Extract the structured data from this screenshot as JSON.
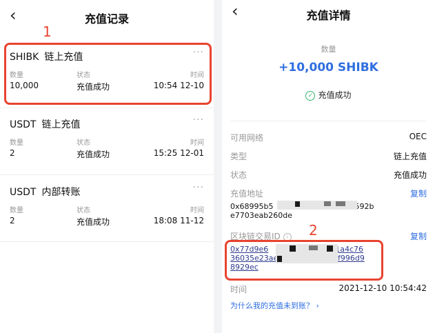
{
  "left": {
    "title": "充值记录",
    "annotation": "1",
    "records": [
      {
        "currency": "SHIBK",
        "type": "链上充值",
        "more": "···",
        "qty_label": "数量",
        "qty": "10,000",
        "status_label": "状态",
        "status": "充值成功",
        "time_label": "时间",
        "time": "10:54 12-10"
      },
      {
        "currency": "USDT",
        "type": "链上充值",
        "more": "···",
        "qty_label": "数量",
        "qty": "2",
        "status_label": "状态",
        "status": "充值成功",
        "time_label": "时间",
        "time": "15:25 12-01"
      },
      {
        "currency": "USDT",
        "type": "内部转账",
        "more": "···",
        "qty_label": "数量",
        "qty": "2",
        "status_label": "状态",
        "status": "充值成功",
        "time_label": "时间",
        "time": "18:08 11-12"
      }
    ]
  },
  "right": {
    "title": "充值详情",
    "amount_label": "数量",
    "amount": "+10,000 SHIBK",
    "status": "充值成功",
    "annotation": "2",
    "rows": {
      "network": {
        "label": "可用网络",
        "value": "OEC"
      },
      "type": {
        "label": "类型",
        "value": "链上充值"
      },
      "status": {
        "label": "状态",
        "value": "充值成功"
      }
    },
    "address_label": "充值地址",
    "copy_label": "复制",
    "address_line1_start": "0x68995b5",
    "address_line1_end": "592b",
    "address_line2": "e7703eab260de",
    "txid_label": "区块链交易ID",
    "txid_line1_start": "0x77d9e6",
    "txid_line1_end": "61a4c76",
    "txid_line2_start": "36035e23ae",
    "txid_line2_end": "af996d9",
    "txid_line3": "8929ec",
    "time_label": "时间",
    "time_value": "2021-12-10 10:54:42",
    "help_link": "为什么我的充值未到账？ ›"
  },
  "icons": {
    "back": "chevron-left-icon",
    "more": "more-dots-icon",
    "success": "check-circle-icon",
    "info": "info-icon"
  },
  "colors": {
    "accent": "#2f6ee0",
    "annotation": "#e8432f",
    "success": "#34b56b"
  }
}
